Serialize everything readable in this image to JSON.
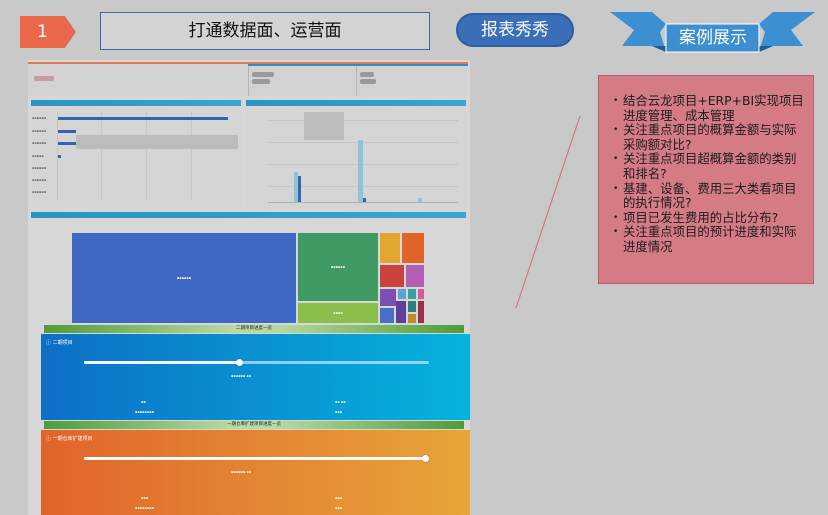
{
  "header": {
    "step_number": "1",
    "title": "打通数据面、运营面",
    "report_button_label": "报表秀秀",
    "case_ribbon_label": "案例展示"
  },
  "dashboard": {
    "progress_section_1": {
      "header": "二期项目进度一览",
      "card_title": "二期项目",
      "progress": 0.45
    },
    "progress_section_2": {
      "header": "一期仓库扩建项目进度一览",
      "card_title": "一期仓库扩建项目",
      "progress": 0.99
    }
  },
  "callout": {
    "items": [
      "结合云龙项目+ERP+BI实现项目进度管理、成本管理",
      "关注重点项目的概算金额与实际采购额对比?",
      "关注重点项目超概算金额的类别和排名?",
      "基建、设备、费用三大类看项目的执行情况?",
      "项目已发生费用的占比分布?",
      "关注重点项目的预计进度和实际进度情况"
    ]
  },
  "colors": {
    "step_badge": "#e9684b",
    "report_pill": "#3a6fb8",
    "ribbon": "#3c8fd0",
    "callout_bg": "#d47b86",
    "progress_card_1": "#0a8fd0",
    "progress_card_2": "#e0642a"
  }
}
